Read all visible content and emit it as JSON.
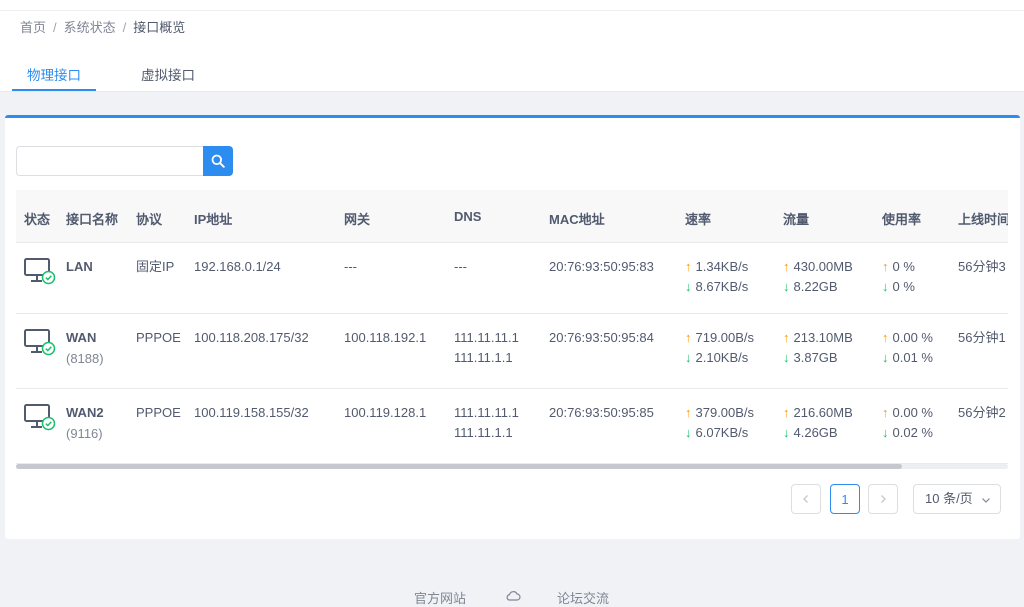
{
  "breadcrumb": [
    "首页",
    "系统状态",
    "接口概览"
  ],
  "tabs": [
    {
      "label": "物理接口",
      "active": true
    },
    {
      "label": "虚拟接口",
      "active": false
    }
  ],
  "search": {
    "value": "",
    "placeholder": ""
  },
  "table": {
    "headers": [
      "状态",
      "接口名称",
      "协议",
      "IP地址",
      "网关",
      "DNS",
      "MAC地址",
      "速率",
      "流量",
      "使用率",
      "上线时间"
    ],
    "rows": [
      {
        "name": "LAN",
        "name_sub": "",
        "protocol": "固定IP",
        "ip": "192.168.0.1/24",
        "gateway": "---",
        "dns1": "---",
        "dns2": "",
        "mac": "20:76:93:50:95:83",
        "rate_up": "1.34KB/s",
        "rate_down": "8.67KB/s",
        "traffic_up": "430.00MB",
        "traffic_down": "8.22GB",
        "usage_up": "0 %",
        "usage_down": "0 %",
        "online": "56分钟3"
      },
      {
        "name": "WAN",
        "name_sub": "(8188)",
        "protocol": "PPPOE",
        "ip": "100.118.208.175/32",
        "gateway": "100.118.192.1",
        "dns1": "111.11.11.1",
        "dns2": "111.11.1.1",
        "mac": "20:76:93:50:95:84",
        "rate_up": "719.00B/s",
        "rate_down": "2.10KB/s",
        "traffic_up": "213.10MB",
        "traffic_down": "3.87GB",
        "usage_up": "0.00 %",
        "usage_down": "0.01 %",
        "online": "56分钟1"
      },
      {
        "name": "WAN2",
        "name_sub": "(9116)",
        "protocol": "PPPOE",
        "ip": "100.119.158.155/32",
        "gateway": "100.119.128.1",
        "dns1": "111.11.11.1",
        "dns2": "111.11.1.1",
        "mac": "20:76:93:50:95:85",
        "rate_up": "379.00B/s",
        "rate_down": "6.07KB/s",
        "traffic_up": "216.60MB",
        "traffic_down": "4.26GB",
        "usage_up": "0.00 %",
        "usage_down": "0.02 %",
        "online": "56分钟2"
      }
    ]
  },
  "pagination": {
    "current_page": "1",
    "page_size": "10 条/页"
  },
  "footer": {
    "link1": "官方网站",
    "link2": "论坛交流"
  },
  "icons": {
    "search": "search-icon",
    "status": "monitor-connected-icon",
    "up": "arrow-up-icon",
    "down": "arrow-down-icon",
    "cloud": "cloud-icon"
  },
  "colors": {
    "accent": "#2d8cf0",
    "up": "#ff9900",
    "down": "#19be6b",
    "status_ok": "#19be6b"
  }
}
